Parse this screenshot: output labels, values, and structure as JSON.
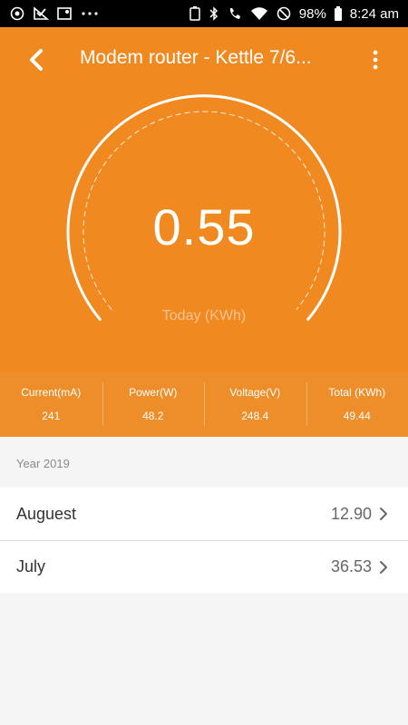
{
  "status_bar": {
    "battery": "98%",
    "time": "8:24 am",
    "icons_left": [
      "sync-icon",
      "check-icon",
      "map-icon",
      "more-dots-icon"
    ],
    "icons_right": [
      "battery-saver-icon",
      "bluetooth-icon",
      "wifi-call-icon",
      "wifi-icon",
      "dnd-icon",
      "battery-icon"
    ]
  },
  "header": {
    "title": "Modem router - Kettle 7/6...",
    "back_icon": "chevron-left-icon",
    "menu_icon": "more-vertical-icon",
    "background": "#f0891f"
  },
  "gauge": {
    "value": "0.55",
    "unit_label": "Today (KWh)",
    "fraction": 0.0
  },
  "stats": [
    {
      "label": "Current(mA)",
      "value": "241"
    },
    {
      "label": "Power(W)",
      "value": "48.2"
    },
    {
      "label": "Voltage(V)",
      "value": "248.4"
    },
    {
      "label": "Total (KWh)",
      "value": "49.44"
    }
  ],
  "section": {
    "label": "Year 2019"
  },
  "months": [
    {
      "name": "Auguest",
      "value": "12.90"
    },
    {
      "name": "July",
      "value": "36.53"
    }
  ]
}
